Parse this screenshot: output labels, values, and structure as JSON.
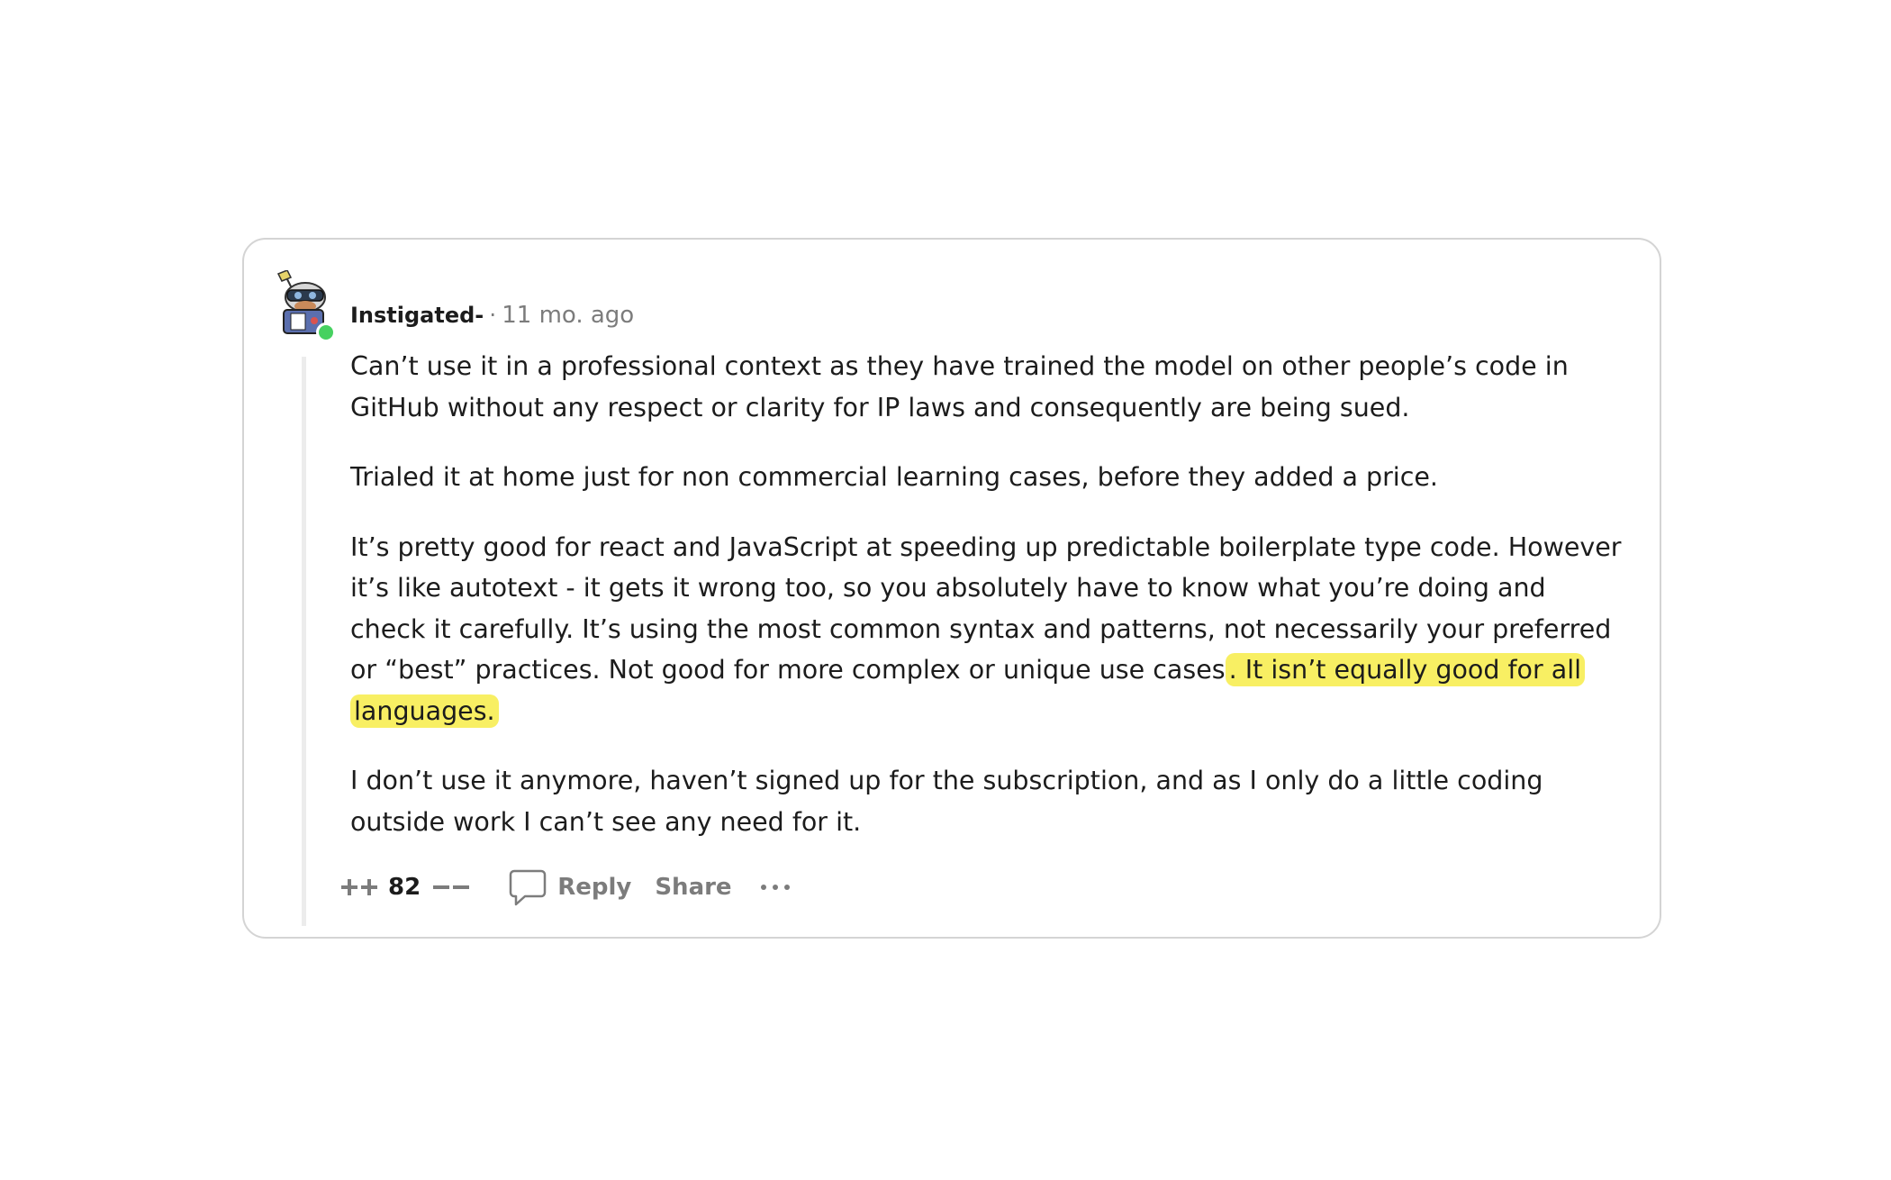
{
  "comment": {
    "username": "Instigated-",
    "separator": "·",
    "timestamp": "11 mo. ago",
    "paragraphs": [
      {
        "text": "Can’t use it in a professional context as they have trained the model on other people’s code in GitHub without any respect or clarity for IP laws and consequently are being sued.",
        "highlight": ""
      },
      {
        "text": "Trialed it at home just for non commercial learning cases, before they added a price.",
        "highlight": ""
      },
      {
        "text": "It’s pretty good for react and JavaScript at speeding up predictable boilerplate type code. However it’s like autotext - it gets it wrong too, so you absolutely have to know what you’re doing and check it carefully. It’s using the most common syntax and patterns, not necessarily your preferred or “best” practices. Not good for more complex or unique use cases",
        "highlight": ". It isn’t equally good for all languages."
      },
      {
        "text": "I don’t use it anymore, haven’t signed up for the subscription, and as I only do a little coding outside work I can’t see any need for it.",
        "highlight": ""
      }
    ],
    "highlight_color": "#f8ef63"
  },
  "actions": {
    "upvote_icon": "upvote-icon",
    "vote_count": "82",
    "downvote_icon": "downvote-icon",
    "reply_icon": "comment-bubble-icon",
    "reply_label": "Reply",
    "share_label": "Share",
    "more_icon": "more-options-icon"
  },
  "colors": {
    "border": "#d4d4d4",
    "muted_text": "#7c7c7c",
    "online": "#46d160",
    "thread_line": "#ececec"
  }
}
